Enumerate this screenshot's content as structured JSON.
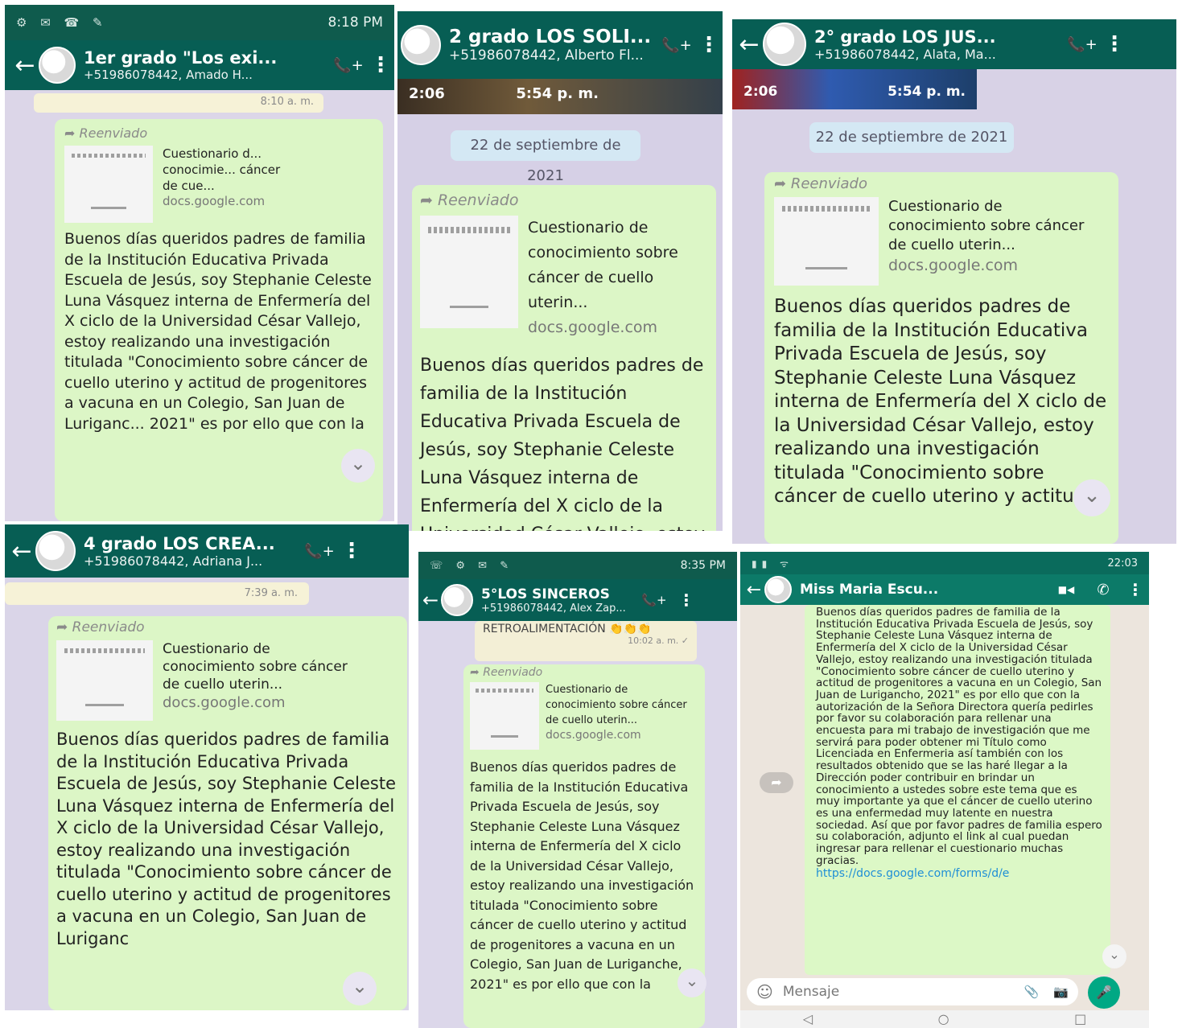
{
  "panels": [
    {
      "id": "p1",
      "status_time": "8:18 PM",
      "chat_title": "1er grado \"Los exi...",
      "chat_subtitle": "+51986078442, Amado H...",
      "prev_time": "8:10 a. m.",
      "forwarded": "Reenviado",
      "preview_title": "Cuestionario d... conocimie... cáncer de cue...",
      "preview_domain": "docs.google.com",
      "message": "Buenos días queridos padres de familia de la Institución Educativa Privada Escuela de Jesús, soy Stephanie Celeste Luna Vásquez interna de Enfermería  del X ciclo de la Universidad César Vallejo, estoy realizando una investigación titulada \"Conocimiento sobre cáncer de cuello uterino y actitud de progenitores a vacuna en un Colegio, San Juan de Luriganc... 2021\"  es por ello que con la"
    },
    {
      "id": "p2",
      "chat_title": "2 grado LOS SOLI...",
      "chat_subtitle": "+51986078442, Alberto Fl...",
      "video_duration": "2:06",
      "video_time": "5:54 p. m.",
      "date_label": "22 de septiembre de 2021",
      "forwarded": "Reenviado",
      "preview_title": "Cuestionario de conocimiento sobre cáncer de cuello uterin...",
      "preview_domain": "docs.google.com",
      "message": "Buenos días queridos padres de familia de la Institución Educativa Privada Escuela de Jesús, soy Stephanie Celeste Luna Vásquez interna de Enfermería  del X ciclo de la Universidad César Vallejo, estoy"
    },
    {
      "id": "p3",
      "chat_title": "2° grado LOS JUS...",
      "chat_subtitle": "+51986078442, Alata, Ma...",
      "video_duration": "2:06",
      "video_time": "5:54 p. m.",
      "date_label": "22 de septiembre de 2021",
      "forwarded": "Reenviado",
      "preview_title": "Cuestionario de conocimiento sobre cáncer de cuello uterin...",
      "preview_domain": "docs.google.com",
      "message": "Buenos días queridos padres de familia de la Institución Educativa Privada Escuela de Jesús, soy Stephanie Celeste Luna Vásquez interna de Enfermería  del X ciclo de la Universidad César Vallejo, estoy realizando una investigación titulada \"Conocimiento sobre cáncer de cuello uterino y actitud"
    },
    {
      "id": "p4",
      "chat_title": "4 grado LOS CREA...",
      "chat_subtitle": "+51986078442, Adriana J...",
      "prev_time": "7:39 a. m.",
      "forwarded": "Reenviado",
      "preview_title": "Cuestionario de conocimiento sobre cáncer de cuello uterin...",
      "preview_domain": "docs.google.com",
      "message": "Buenos días queridos padres de familia de la Institución Educativa Privada Escuela de Jesús, soy Stephanie Celeste Luna Vásquez interna de Enfermería  del X ciclo de la Universidad César Vallejo, estoy realizando una investigación titulada \"Conocimiento sobre cáncer de cuello uterino y actitud de progenitores a vacuna en un Colegio, San Juan de Luriganc"
    },
    {
      "id": "p5",
      "status_time": "8:35 PM",
      "chat_title": "5°LOS SINCEROS",
      "chat_subtitle": "+51986078442, Alex Zap...",
      "prev_message": "RETROALIMENTACIÓN 👏👏👏",
      "prev_time": "10:02 a. m. ✓",
      "forwarded": "Reenviado",
      "preview_title": "Cuestionario de conocimiento sobre cáncer de cuello uterin...",
      "preview_domain": "docs.google.com",
      "message": "Buenos días queridos padres de familia de la Institución Educativa Privada Escuela de Jesús, soy Stephanie Celeste Luna Vásquez interna de Enfermería  del X ciclo de la Universidad César Vallejo, estoy realizando una investigación titulada \"Conocimiento sobre cáncer de cuello uterino y actitud de progenitores a vacuna en un Colegio, San Juan de Luriganche, 2021\"  es por ello que con la"
    },
    {
      "id": "p6",
      "status_time": "22:03",
      "chat_title": "Miss Maria Escu...",
      "message": "Buenos días queridos padres de familia de la Institución Educativa Privada Escuela de Jesús, soy Stephanie Celeste Luna Vásquez interna de Enfermería  del X ciclo de la Universidad César Vallejo, estoy realizando una investigación titulada \"Conocimiento sobre cáncer de cuello uterino y actitud de progenitores a vacuna en un Colegio, San Juan de Lurigancho, 2021\"  es por ello que con la autorización de la Señora Directora quería pedirles por favor su colaboración para rellenar una encuesta para mi trabajo de investigación que me servirá para poder obtener mi Título como Licenciada en Enfermeria así también con los resultados obtenido que se las haré llegar a la Dirección poder contribuir en brindar un conocimiento a ustedes sobre este tema que es muy importante ya que el cáncer de cuello uterino es una enfermedad muy latente en nuestra sociedad. Así que por favor padres de familia espero su colaboración, adjunto el link al cual puedan ingresar para rellenar el cuestionario muchas gracias.",
      "link": "https://docs.google.com/forms/d/e",
      "input_placeholder": "Mensaje"
    }
  ],
  "icons": {
    "back": "←",
    "call_add": "📞+",
    "menu": "⋮",
    "video_cam": "■◀",
    "phone": "✆",
    "scroll_down": "⌄",
    "emoji": "☺",
    "attach": "📎",
    "camera": "📷",
    "mic": "🎤",
    "forward_arrow": "➦",
    "nav_back": "◁",
    "nav_home": "○",
    "nav_recent": "□"
  }
}
